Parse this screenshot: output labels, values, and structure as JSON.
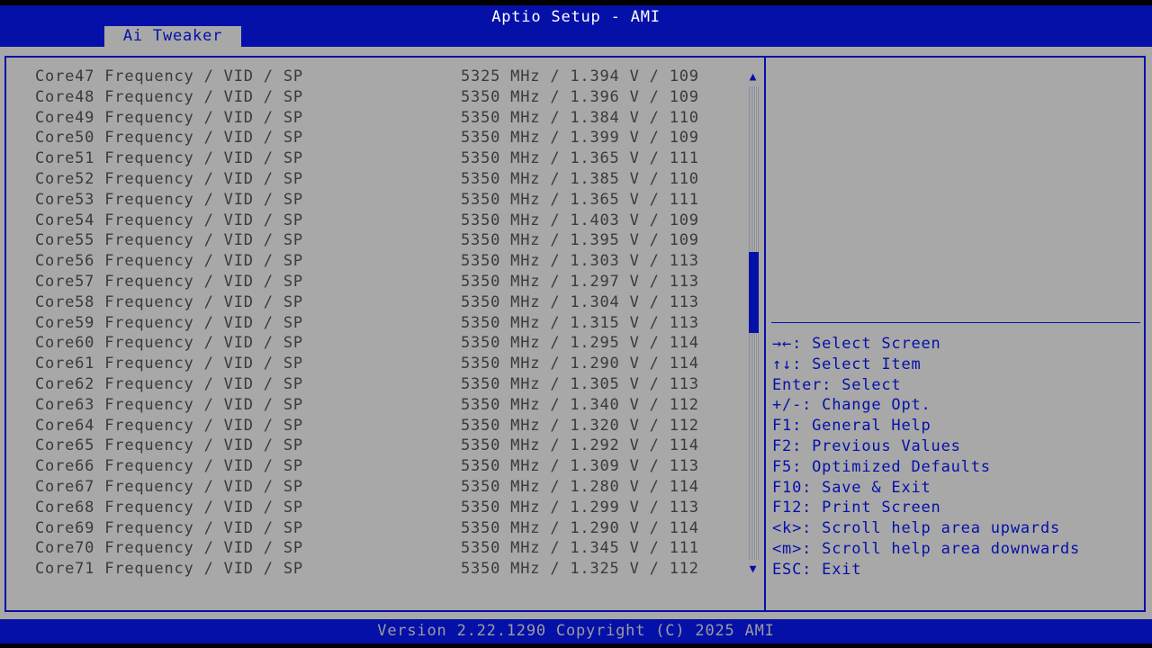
{
  "header": {
    "title": "Aptio Setup - AMI",
    "active_tab": "Ai Tweaker"
  },
  "rows": [
    {
      "label": "Core47 Frequency / VID / SP",
      "value": "5325 MHz / 1.394 V / 109"
    },
    {
      "label": "Core48 Frequency / VID / SP",
      "value": "5350 MHz / 1.396 V / 109"
    },
    {
      "label": "Core49 Frequency / VID / SP",
      "value": "5350 MHz / 1.384 V / 110"
    },
    {
      "label": "Core50 Frequency / VID / SP",
      "value": "5350 MHz / 1.399 V / 109"
    },
    {
      "label": "Core51 Frequency / VID / SP",
      "value": "5350 MHz / 1.365 V / 111"
    },
    {
      "label": "Core52 Frequency / VID / SP",
      "value": "5350 MHz / 1.385 V / 110"
    },
    {
      "label": "Core53 Frequency / VID / SP",
      "value": "5350 MHz / 1.365 V / 111"
    },
    {
      "label": "Core54 Frequency / VID / SP",
      "value": "5350 MHz / 1.403 V / 109"
    },
    {
      "label": "Core55 Frequency / VID / SP",
      "value": "5350 MHz / 1.395 V / 109"
    },
    {
      "label": "Core56 Frequency / VID / SP",
      "value": "5350 MHz / 1.303 V / 113"
    },
    {
      "label": "Core57 Frequency / VID / SP",
      "value": "5350 MHz / 1.297 V / 113"
    },
    {
      "label": "Core58 Frequency / VID / SP",
      "value": "5350 MHz / 1.304 V / 113"
    },
    {
      "label": "Core59 Frequency / VID / SP",
      "value": "5350 MHz / 1.315 V / 113"
    },
    {
      "label": "Core60 Frequency / VID / SP",
      "value": "5350 MHz / 1.295 V / 114"
    },
    {
      "label": "Core61 Frequency / VID / SP",
      "value": "5350 MHz / 1.290 V / 114"
    },
    {
      "label": "Core62 Frequency / VID / SP",
      "value": "5350 MHz / 1.305 V / 113"
    },
    {
      "label": "Core63 Frequency / VID / SP",
      "value": "5350 MHz / 1.340 V / 112"
    },
    {
      "label": "Core64 Frequency / VID / SP",
      "value": "5350 MHz / 1.320 V / 112"
    },
    {
      "label": "Core65 Frequency / VID / SP",
      "value": "5350 MHz / 1.292 V / 114"
    },
    {
      "label": "Core66 Frequency / VID / SP",
      "value": "5350 MHz / 1.309 V / 113"
    },
    {
      "label": "Core67 Frequency / VID / SP",
      "value": "5350 MHz / 1.280 V / 114"
    },
    {
      "label": "Core68 Frequency / VID / SP",
      "value": "5350 MHz / 1.299 V / 113"
    },
    {
      "label": "Core69 Frequency / VID / SP",
      "value": "5350 MHz / 1.290 V / 114"
    },
    {
      "label": "Core70 Frequency / VID / SP",
      "value": "5350 MHz / 1.345 V / 111"
    },
    {
      "label": "Core71 Frequency / VID / SP",
      "value": "5350 MHz / 1.325 V / 112"
    }
  ],
  "help_keys": [
    "→←: Select Screen",
    "↑↓: Select Item",
    "Enter: Select",
    "+/-: Change Opt.",
    "F1: General Help",
    "F2: Previous Values",
    "F5: Optimized Defaults",
    "F10: Save & Exit",
    "F12: Print Screen",
    "<k>: Scroll help area upwards",
    "<m>: Scroll help area downwards",
    "ESC: Exit"
  ],
  "footer": {
    "text": "Version 2.22.1290 Copyright (C) 2025 AMI"
  },
  "scrollbar": {
    "up_glyph": "▲",
    "down_glyph": "▼"
  },
  "colors": {
    "accent_blue": "#0410a8",
    "panel_gray": "#a8a8a8",
    "text_dark": "#3a3a3a",
    "title_white": "#ffffff",
    "footer_text": "#9c9c9c"
  }
}
